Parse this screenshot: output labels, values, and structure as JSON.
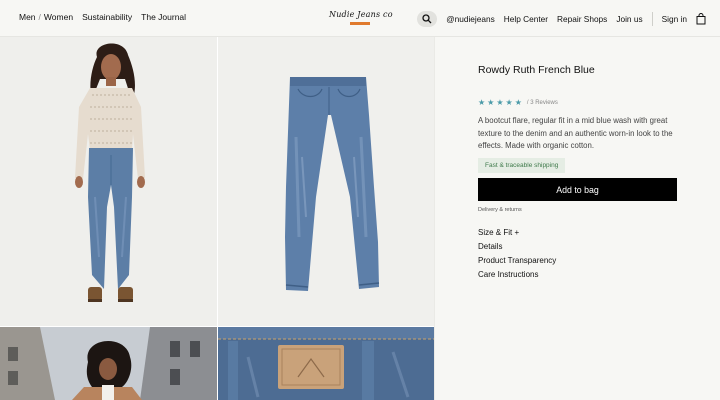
{
  "header": {
    "nav_left": {
      "men": "Men",
      "slash": "/",
      "women": "Women",
      "sustainability": "Sustainability",
      "journal": "The Journal"
    },
    "logo_text": "Nudie Jeans co",
    "nav_right": {
      "instagram": "@nudiejeans",
      "help": "Help Center",
      "repair": "Repair Shops",
      "join": "Join us",
      "signin": "Sign in"
    }
  },
  "product": {
    "title": "Rowdy Ruth French Blue",
    "stars": 5,
    "reviews": "/ 3 Reviews",
    "description": "A bootcut flare, regular fit in a mid blue  wash with great texture to the denim and an authentic worn-in look to the effects. Made with organic cotton.",
    "shipping_badge": "Fast & traceable shipping",
    "add_to_bag": "Add to bag",
    "delivery": "Delivery & returns",
    "accordions": [
      "Size & Fit +",
      "Details",
      "Product Transparency",
      "Care Instructions"
    ]
  },
  "colors": {
    "accent": "#e07a2d",
    "star": "#4a9aa8",
    "button": "#000000",
    "badge_bg": "#e5ede4",
    "badge_text": "#3f7a4b"
  }
}
